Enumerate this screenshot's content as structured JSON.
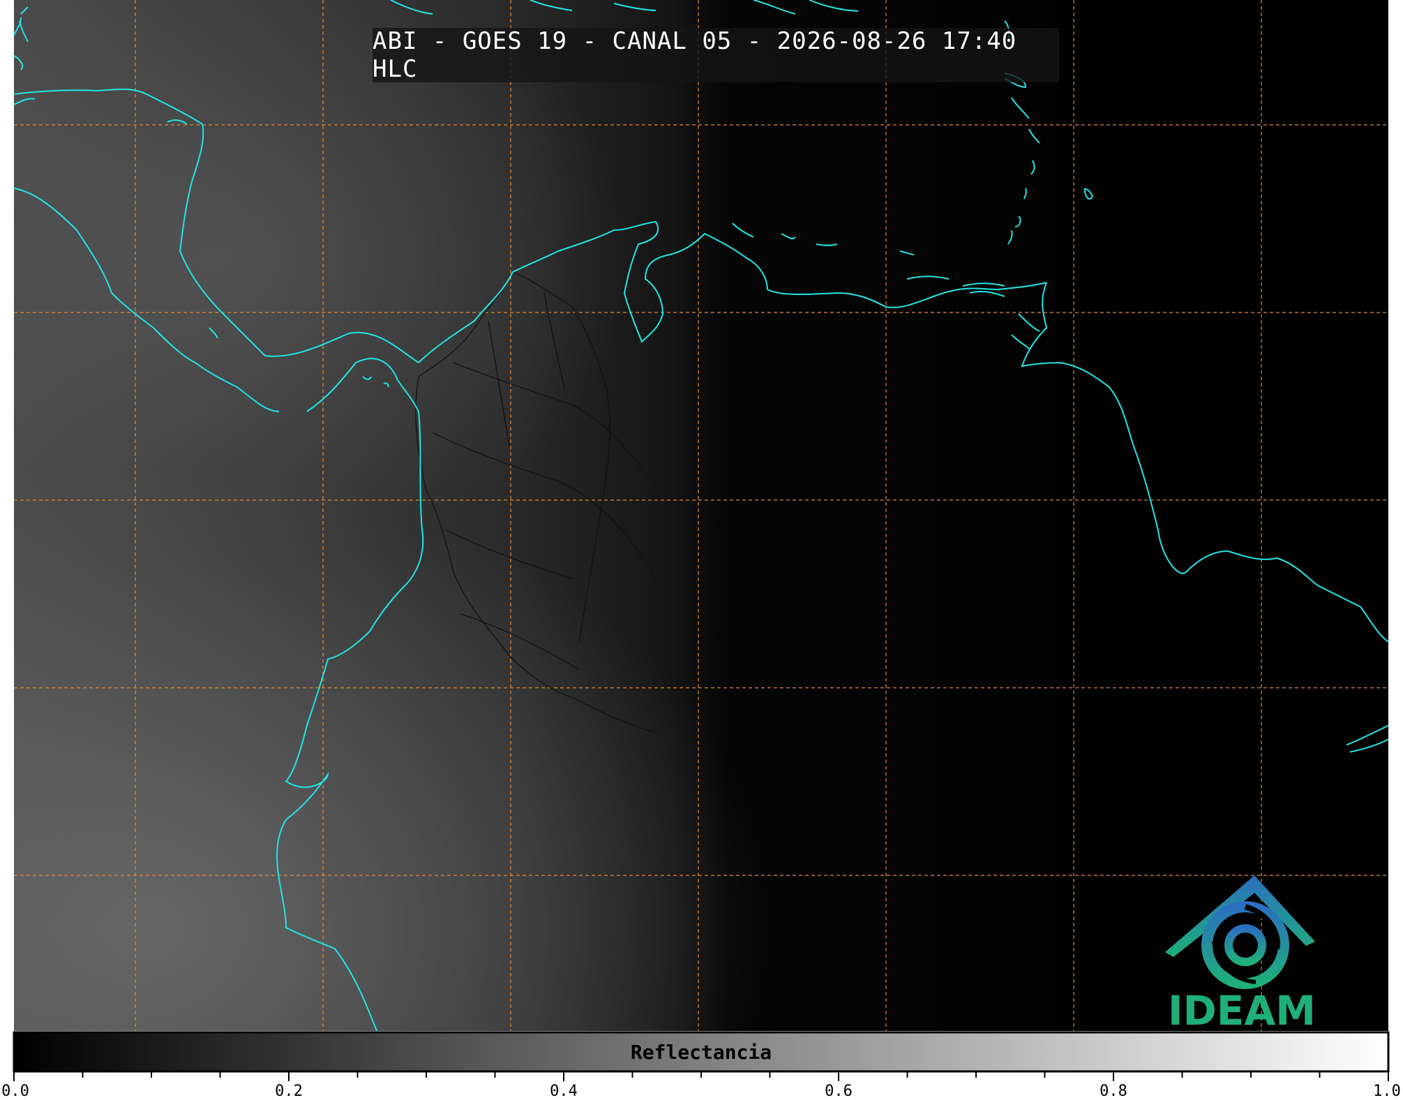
{
  "title": "ABI - GOES 19 - CANAL 05 - 2026-08-26 17:40 HLC",
  "logo": {
    "text": "IDEAM",
    "icon": "ideam-logo-icon",
    "color": "#1fb07a"
  },
  "colorbar": {
    "label": "Reflectancia",
    "min": 0.0,
    "max": 1.0,
    "ticks": [
      "0.0",
      "0.2",
      "0.4",
      "0.6",
      "0.8",
      "1.0"
    ],
    "colormap": [
      "#000000",
      "#ffffff"
    ]
  },
  "map_style": {
    "coastline_color": "#22e5e5",
    "border_color": "#111111",
    "gridline_color": "#e08a3a",
    "gridline_style": "dashed",
    "grid_rows": 5,
    "grid_cols": 7
  }
}
